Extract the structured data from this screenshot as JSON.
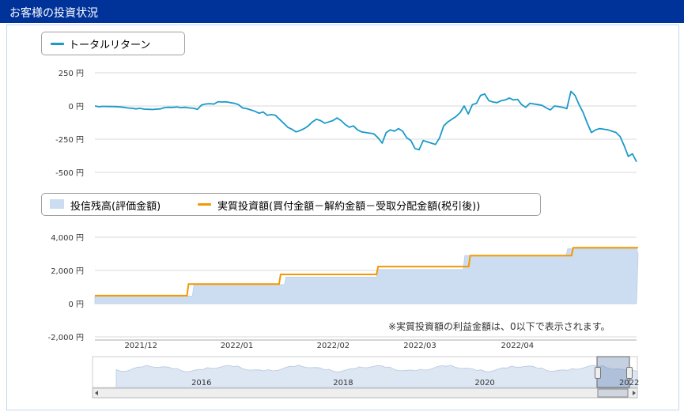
{
  "header": {
    "title": "お客様の投資状況"
  },
  "legend_top": {
    "label": "トータルリターン",
    "color": "#1a9ac9"
  },
  "legend_bottom": {
    "area_label": "投信残高(評価金額)",
    "area_color": "#cdddf1",
    "line_label": "実質投資額(買付金額－解約金額－受取分配金額(税引後))",
    "line_color": "#f39800"
  },
  "note": "※実質投資額の利益金額は、0以下で表示されます。",
  "chart_data": [
    {
      "type": "line",
      "ylim": [
        -500,
        250
      ],
      "y_ticks": [
        250,
        0,
        -250,
        -500
      ],
      "y_tick_labels": [
        "250 円",
        "0 円",
        "-250 円",
        "-500 円"
      ],
      "series": [
        {
          "name": "トータルリターン",
          "values": [
            0,
            -6,
            -3,
            -4,
            -4,
            -5,
            -7,
            -10,
            -15,
            -17,
            -22,
            -18,
            -24,
            -25,
            -27,
            -24,
            -22,
            -12,
            -10,
            -11,
            -8,
            -13,
            -10,
            -15,
            -17,
            -25,
            8,
            15,
            17,
            14,
            32,
            30,
            31,
            25,
            20,
            10,
            -15,
            -20,
            -30,
            -40,
            -55,
            -45,
            -70,
            -65,
            -70,
            -100,
            -130,
            -160,
            -175,
            -195,
            -185,
            -170,
            -150,
            -120,
            -100,
            -110,
            -130,
            -120,
            -110,
            -90,
            -110,
            -140,
            -160,
            -150,
            -180,
            -195,
            -200,
            -205,
            -210,
            -240,
            -280,
            -200,
            -180,
            -190,
            -170,
            -190,
            -240,
            -260,
            -320,
            -330,
            -260,
            -270,
            -280,
            -290,
            -240,
            -150,
            -120,
            -100,
            -80,
            -50,
            0,
            -60,
            10,
            20,
            80,
            90,
            40,
            30,
            25,
            40,
            45,
            60,
            45,
            50,
            10,
            -10,
            20,
            15,
            10,
            5,
            -15,
            -30,
            0,
            -5,
            -10,
            -20,
            110,
            80,
            10,
            -50,
            -130,
            -200,
            -180,
            -170,
            -175,
            -180,
            -190,
            -200,
            -230,
            -300,
            -380,
            -360,
            -420
          ]
        }
      ]
    },
    {
      "type": "area",
      "ylim": [
        -2000,
        4000
      ],
      "y_ticks": [
        4000,
        2000,
        0,
        -2000
      ],
      "y_tick_labels": [
        "4,000 円",
        "2,000 円",
        "0 円",
        "-2,000 円"
      ],
      "x_tick_labels": [
        "2021/12",
        "2022/01",
        "2022/02",
        "2022/03",
        "2022/04"
      ],
      "x_tick_positions": [
        0.085,
        0.262,
        0.44,
        0.6,
        0.78
      ],
      "series": [
        {
          "name": "投信残高(評価金額)",
          "steps": [
            [
              0,
              450
            ],
            [
              0.18,
              1150
            ],
            [
              0.35,
              1600
            ],
            [
              0.52,
              2050
            ],
            [
              0.68,
              2900
            ],
            [
              0.87,
              3300
            ],
            [
              0.98,
              3300
            ],
            [
              1,
              3000
            ]
          ]
        },
        {
          "name": "実質投資額(買付金額－解約金額－受取分配金額(税引後))",
          "steps": [
            [
              0,
              480
            ],
            [
              0.17,
              1180
            ],
            [
              0.34,
              1760
            ],
            [
              0.52,
              2230
            ],
            [
              0.69,
              2890
            ],
            [
              0.88,
              3370
            ],
            [
              1,
              3370
            ]
          ]
        }
      ]
    },
    {
      "type": "area",
      "role": "navigator",
      "x_tick_labels": [
        "2016",
        "2018",
        "2020",
        "2022"
      ],
      "x_tick_positions": [
        0.2,
        0.46,
        0.72,
        0.985
      ]
    }
  ]
}
